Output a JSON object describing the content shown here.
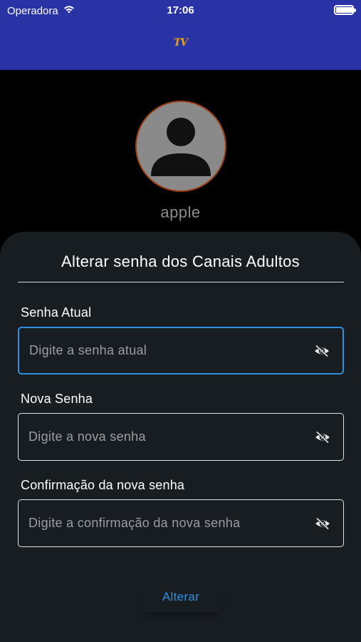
{
  "status_bar": {
    "carrier": "Operadora",
    "time": "17:06",
    "battery_level": 0.95
  },
  "header": {
    "logo_text": "TV",
    "logo_color": "#e8a21a",
    "background_color": "#2a33a6"
  },
  "profile": {
    "avatar_icon": "person-avatar-icon",
    "username": "apple"
  },
  "form": {
    "title": "Alterar senha dos Canais Adultos",
    "fields": [
      {
        "label": "Senha Atual",
        "placeholder": "Digite a senha atual",
        "value": "",
        "icon": "eye-off-icon",
        "focused": true
      },
      {
        "label": "Nova Senha",
        "placeholder": "Digite a nova senha",
        "value": "",
        "icon": "eye-off-icon",
        "focused": false
      },
      {
        "label": "Confirmação da nova senha",
        "placeholder": "Digite a confirmação da nova senha",
        "value": "",
        "icon": "eye-off-icon",
        "focused": false
      }
    ],
    "submit_label": "Alterar",
    "accent_color": "#2f8fe0"
  }
}
